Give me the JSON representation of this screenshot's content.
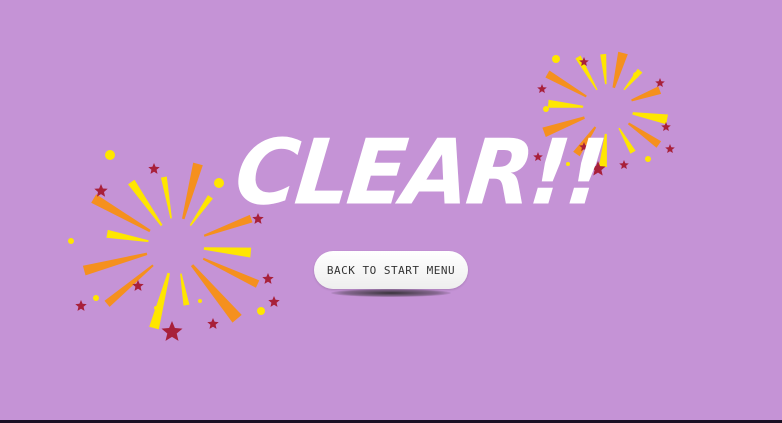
{
  "screen": {
    "background_color": "#c593d6",
    "border_color": "#1a1024"
  },
  "title": {
    "text": "CLEAR!!",
    "color": "#ffffff"
  },
  "menu_button": {
    "label": "BACK TO START MENU"
  },
  "fireworks_colors": {
    "orange": "#f5901e",
    "yellow": "#ffe600",
    "star_red": "#a8203a"
  },
  "decorations": {
    "left_burst_icon": "firework-burst-icon",
    "right_burst_icon": "firework-burst-icon",
    "star_icon": "star-icon"
  }
}
